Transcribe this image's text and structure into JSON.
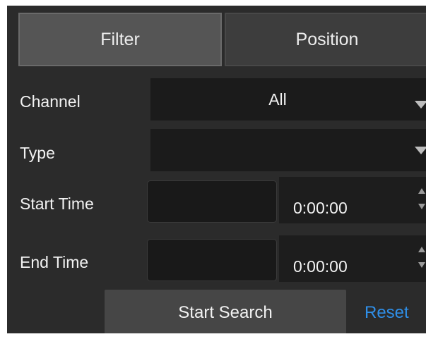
{
  "tabs": [
    {
      "label": "Filter",
      "active": true
    },
    {
      "label": "Position",
      "active": false
    }
  ],
  "fields": {
    "channel": {
      "label": "Channel",
      "value": "All",
      "icon": "dropdown-arrow-icon"
    },
    "type": {
      "label": "Type",
      "value": "",
      "icon": "dropdown-arrow-icon"
    },
    "start_time": {
      "label": "Start Time",
      "date": "",
      "time": "0:00:00",
      "icon": "spinner-arrows-icon"
    },
    "end_time": {
      "label": "End Time",
      "date": "",
      "time": "0:00:00",
      "icon": "spinner-arrows-icon"
    }
  },
  "actions": {
    "search_label": "Start Search",
    "reset_label": "Reset"
  },
  "colors": {
    "panel_background": "#2b2b2b",
    "active_tab": "#555555",
    "inactive_tab": "#3d3d3d",
    "input_background": "#1b1b1b",
    "button_background": "#464646",
    "link_accent": "#2f8fe8"
  }
}
